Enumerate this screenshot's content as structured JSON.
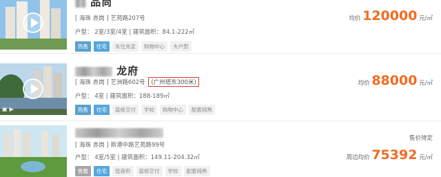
{
  "listings": [
    {
      "title_visible": "品尚",
      "address": "[ 海珠 赤岗 ] 艺苑路207号",
      "highlight": "",
      "type": "户型： 2室/3室/4室  |  建筑面积：84.1-222㎡",
      "tags": [
        {
          "label": "热售",
          "style": "sale"
        },
        {
          "label": "住宅",
          "style": "res"
        },
        {
          "label": "车位充足",
          "style": "plain"
        },
        {
          "label": "购物中心",
          "style": "plain"
        },
        {
          "label": "大户型",
          "style": "plain"
        }
      ],
      "price_prefix": "均价",
      "price_value": "120000",
      "price_unit": "元/㎡",
      "status": ""
    },
    {
      "title_visible": "龙府",
      "address": "[ 海珠 赤岗 ] 艺洲路602号",
      "highlight": "(广州塔东300米)",
      "type": "户型： 4室  |  建筑面积：188-189㎡",
      "tags": [
        {
          "label": "热售",
          "style": "sale"
        },
        {
          "label": "住宅",
          "style": "res"
        },
        {
          "label": "装修交付",
          "style": "plain"
        },
        {
          "label": "学校",
          "style": "plain"
        },
        {
          "label": "购物中心",
          "style": "plain"
        },
        {
          "label": "配套纯熟",
          "style": "plain"
        }
      ],
      "price_prefix": "均价",
      "price_value": "88000",
      "price_unit": "元/㎡",
      "status": ""
    },
    {
      "title_visible": "",
      "address": "[ 海珠 赤岗 ] 新港中路艺苑路99号",
      "highlight": "",
      "type": "户型： 4室/5室  |  建筑面积：149.11-204.32㎡",
      "tags": [
        {
          "label": "售罄",
          "style": "soldout"
        },
        {
          "label": "住宅",
          "style": "res"
        },
        {
          "label": "低容积",
          "style": "plain"
        },
        {
          "label": "装修交付",
          "style": "plain"
        },
        {
          "label": "学校",
          "style": "plain"
        },
        {
          "label": "配套纯熟",
          "style": "plain"
        }
      ],
      "price_prefix": "周边均价",
      "price_value": "75392",
      "price_unit": "元/㎡",
      "status": "售价待定"
    }
  ]
}
